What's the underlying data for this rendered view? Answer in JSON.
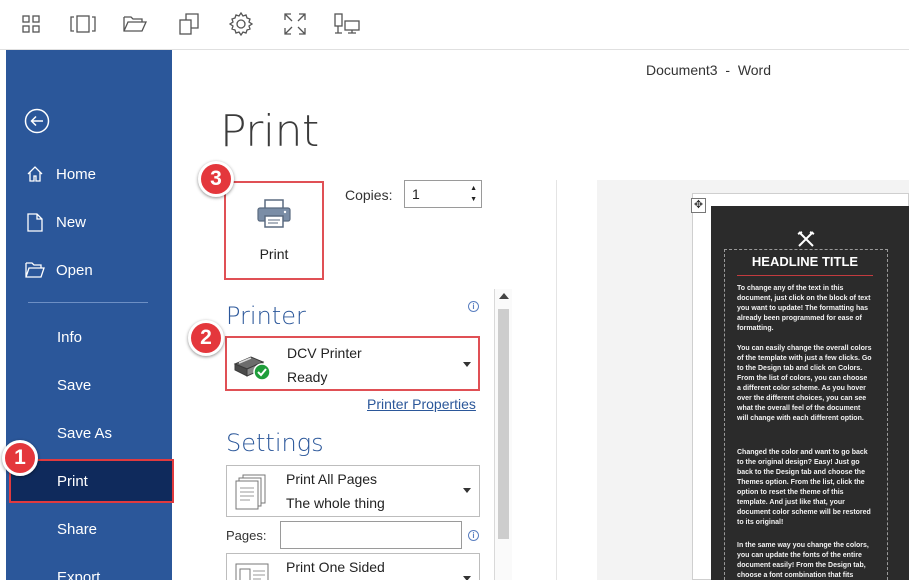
{
  "window": {
    "title": "Document3  -  Word"
  },
  "toolbar": {
    "icons": [
      "grid-icon",
      "columns-icon",
      "folder-open-icon",
      "copy-icon",
      "gear-icon",
      "expand-icon",
      "monitor-icon"
    ]
  },
  "sidebar": {
    "items": [
      {
        "label": "Home",
        "icon": "home-icon"
      },
      {
        "label": "New",
        "icon": "new-doc-icon"
      },
      {
        "label": "Open",
        "icon": "folder-open-icon"
      },
      {
        "label": "Info"
      },
      {
        "label": "Save"
      },
      {
        "label": "Save As"
      },
      {
        "label": "Print",
        "active": true
      },
      {
        "label": "Share"
      },
      {
        "label": "Export"
      }
    ]
  },
  "main": {
    "heading": "Print",
    "print_button_label": "Print",
    "copies_label": "Copies:",
    "copies_value": "1",
    "printer_heading": "Printer",
    "printer_name": "DCV Printer",
    "printer_status": "Ready",
    "printer_properties": "Printer Properties",
    "settings_heading": "Settings",
    "setting_pages_main": "Print All Pages",
    "setting_pages_sub": "The whole thing",
    "pages_label": "Pages:",
    "pages_value": "",
    "setting_sides_main": "Print One Sided"
  },
  "badges": {
    "one": "1",
    "two": "2",
    "three": "3"
  },
  "preview": {
    "headline": "HEADLINE TITLE",
    "p1": "To change any of the text in this document, just click on the block of text you want to update!  The formatting has already been programmed for ease of formatting.",
    "p2": "You can easily change the overall colors of the template with just a few clicks.  Go to the Design tab and click on Colors.  From the list of colors, you can choose a different color scheme.  As you hover over the different choices, you can see what the overall feel of the document will change with each different option.",
    "p3": "Changed the color and want to go back to the original design?  Easy!  Just go back to the Design tab and choose the Themes option.  From the list, click the option to reset the theme of this template.  And just like that, your document color scheme will be restored to its original!",
    "p4": "In the same way you change the colors, you can update the fonts of the entire document easily!  From the Design tab, choose a font combination that fits"
  },
  "colors": {
    "sidebar": "#2b579a",
    "sidebar_active": "#0f2a5c",
    "accent_red": "#e4373c",
    "heading_blue": "#2b579a"
  }
}
